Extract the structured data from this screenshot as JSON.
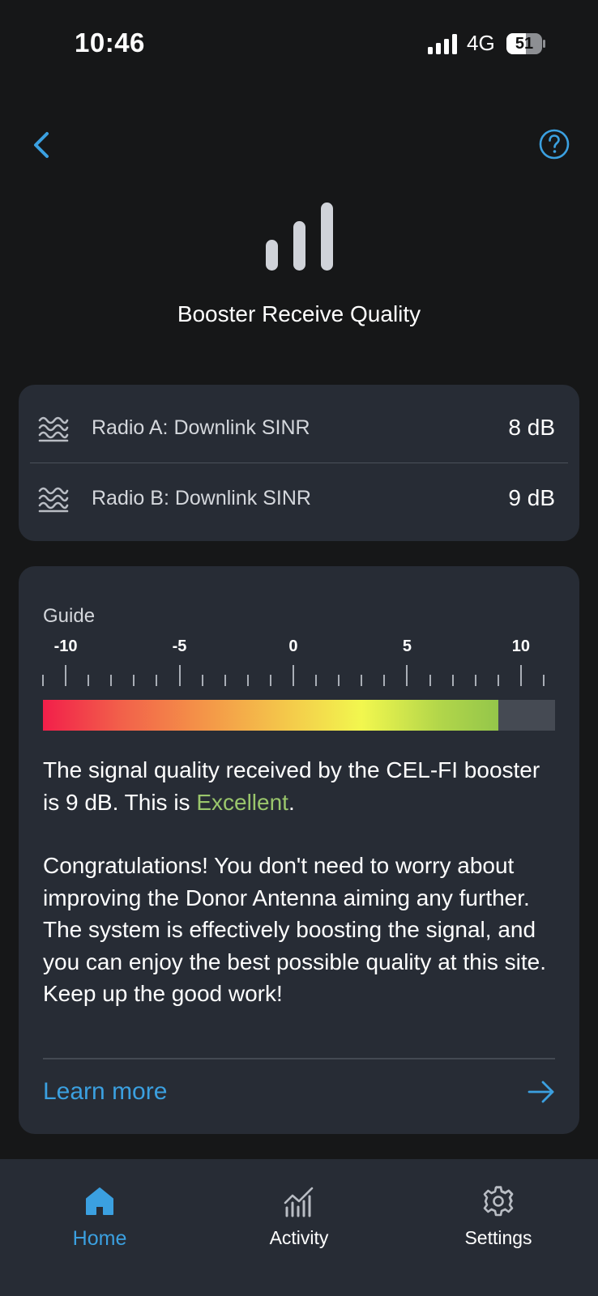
{
  "status_bar": {
    "time": "10:46",
    "network": "4G",
    "battery": "51"
  },
  "nav": {
    "back_icon": "chevron-left-icon",
    "help_icon": "question-circle-icon"
  },
  "header": {
    "icon": "signal-bars-icon",
    "title": "Booster Receive Quality"
  },
  "radios": [
    {
      "icon": "waves-icon",
      "label": "Radio A: Downlink SINR",
      "value": "8 dB"
    },
    {
      "icon": "waves-icon",
      "label": "Radio B: Downlink SINR",
      "value": "9 dB"
    }
  ],
  "guide": {
    "title": "Guide",
    "scale": {
      "min": -11,
      "max": 11.5,
      "labels": [
        "-10",
        "-5",
        "0",
        "5",
        "10"
      ],
      "current_value": 9
    },
    "summary_prefix": "The signal quality received by the CEL-FI booster is 9 dB. This is ",
    "summary_rating": "Excellent",
    "summary_suffix": ".",
    "rating_color": "#9ac66c",
    "body": "Congratulations! You don't need to worry about improving the Donor Antenna aiming any further. The system is effectively boosting the signal, and you can enjoy the best possible quality at this site. Keep up the good work!",
    "learn_more": "Learn more"
  },
  "tabs": [
    {
      "icon": "home-icon",
      "label": "Home",
      "active": true
    },
    {
      "icon": "activity-icon",
      "label": "Activity",
      "active": false
    },
    {
      "icon": "gear-icon",
      "label": "Settings",
      "active": false
    }
  ],
  "colors": {
    "accent": "#3ba0e0",
    "card": "#272c35",
    "background": "#161718"
  }
}
